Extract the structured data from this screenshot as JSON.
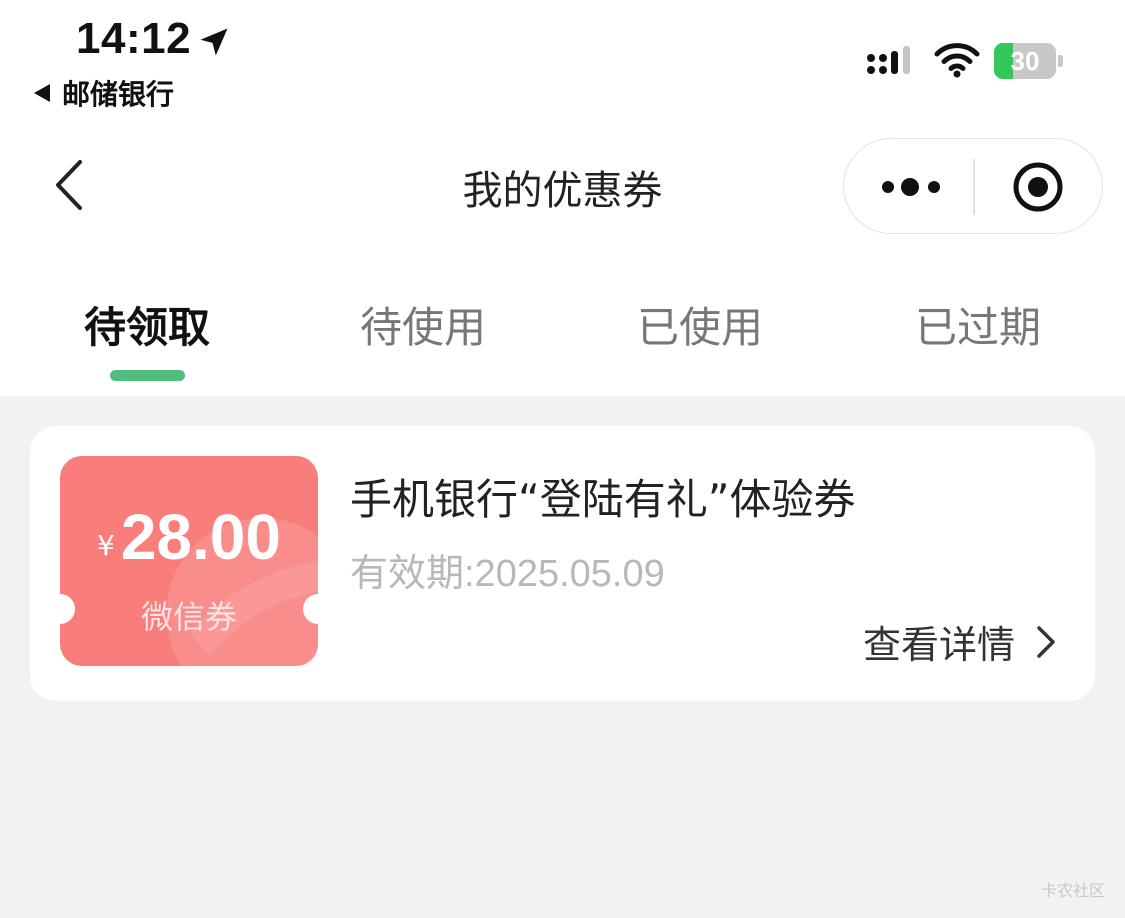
{
  "status_bar": {
    "time": "14:12",
    "back_app_label": "邮储银行",
    "battery_level": "30",
    "battery_fraction": 0.3,
    "icons": [
      "location-arrow-icon",
      "cellular-signal-icon",
      "wifi-icon",
      "battery-icon"
    ]
  },
  "nav": {
    "title": "我的优惠券",
    "back_icon": "chevron-left-icon",
    "more_icon": "more-dots-icon",
    "close_icon": "target-circle-icon"
  },
  "tabs": [
    {
      "label": "待领取",
      "active": true
    },
    {
      "label": "待使用",
      "active": false
    },
    {
      "label": "已使用",
      "active": false
    },
    {
      "label": "已过期",
      "active": false
    }
  ],
  "colors": {
    "accent_green": "#4fbd7e",
    "coupon_red": "#f97d7b",
    "battery_green": "#34c759"
  },
  "coupons": [
    {
      "currency": "¥",
      "amount": "28.00",
      "type": "微信券",
      "title": "手机银行“登陆有礼”体验券",
      "validity": "有效期:2025.05.09",
      "details_label": "查看详情"
    }
  ],
  "watermark": "卡农社区"
}
